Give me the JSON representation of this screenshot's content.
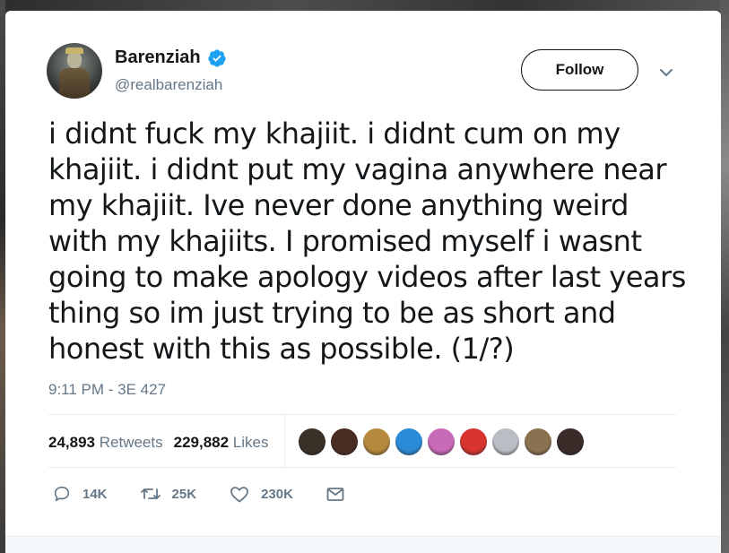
{
  "tweet": {
    "display_name": "Barenziah",
    "handle": "@realbarenziah",
    "follow_label": "Follow",
    "text": "i didnt fuck my khajiit. i didnt cum on my khajiit. i didnt put my vagina anywhere near my khajiit. Ive never done anything weird with my khajiits. I promised myself i wasnt going to make apology videos after last years thing so im just trying to be as short and honest with this as possible. (1/?)",
    "timestamp": "9:11 PM - 3E 427"
  },
  "stats": {
    "retweets_count": "24,893",
    "retweets_label": "Retweets",
    "likes_count": "229,882",
    "likes_label": "Likes"
  },
  "likers": [
    {
      "icon": "liker-avatar",
      "color": "#3a3026"
    },
    {
      "icon": "liker-avatar",
      "color": "#4a2d22"
    },
    {
      "icon": "liker-avatar",
      "color": "#b58a3f"
    },
    {
      "icon": "liker-avatar",
      "color": "#2a8bd6"
    },
    {
      "icon": "liker-avatar",
      "color": "#c86ab8"
    },
    {
      "icon": "liker-avatar",
      "color": "#d8342f"
    },
    {
      "icon": "liker-avatar",
      "color": "#b8bec4"
    },
    {
      "icon": "liker-avatar",
      "color": "#8a7250"
    },
    {
      "icon": "liker-avatar",
      "color": "#3b2c2a"
    }
  ],
  "actions": {
    "reply_count": "14K",
    "retweet_count": "25K",
    "like_count": "230K"
  },
  "colors": {
    "verified": "#1da1f2",
    "text_primary": "#14171a",
    "text_secondary": "#657786"
  }
}
